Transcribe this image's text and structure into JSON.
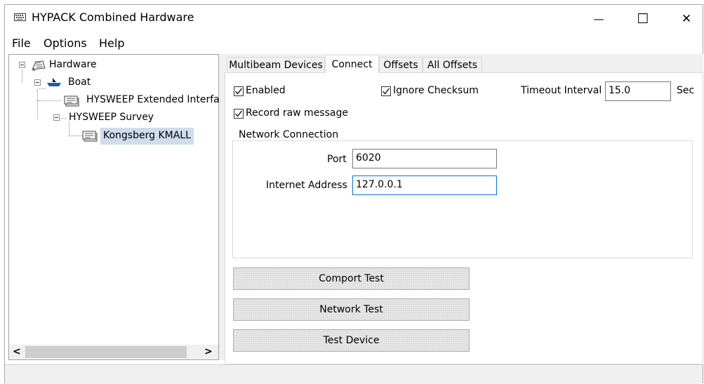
{
  "window": {
    "title": "HYPACK Combined Hardware",
    "minimize_glyph": "—",
    "maximize_glyph": "☐",
    "close_glyph": "✕"
  },
  "menu": [
    "File",
    "Options",
    "Help"
  ],
  "tree": {
    "root": "Hardware",
    "boat": "Boat",
    "extended": "HYSWEEP Extended Interfa",
    "survey": "HYSWEEP Survey",
    "device": "Kongsberg KMALL"
  },
  "scroll": {
    "left": "<",
    "right": ">"
  },
  "tabs": [
    "Multibeam Devices",
    "Connect",
    "Offsets",
    "All Offsets"
  ],
  "connect": {
    "enabled_label": "Enabled",
    "enabled": true,
    "ignore_checksum_label": "Ignore Checksum",
    "ignore_checksum": true,
    "record_raw_label": "Record raw message",
    "record_raw": true,
    "timeout_label": "Timeout Interval",
    "timeout_value": "15.0",
    "timeout_unit": "Sec",
    "network_group": "Network Connection",
    "port_label": "Port",
    "port_value": "6020",
    "address_label": "Internet Address",
    "address_value": "127.0.0.1"
  },
  "buttons": {
    "comport_test": "Comport Test",
    "network_test": "Network Test",
    "test_device": "Test Device"
  },
  "icons": {
    "app": "keyboard-icon",
    "hardware": "hardware-icon",
    "boat": "boat-icon",
    "device": "device-icon"
  }
}
